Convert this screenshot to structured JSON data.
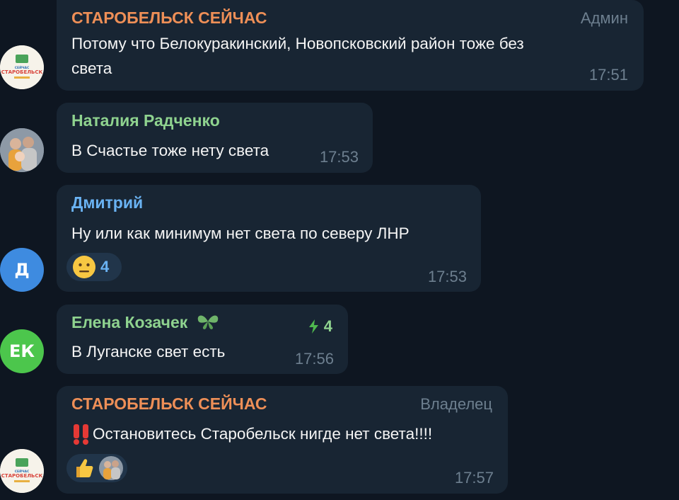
{
  "messages": [
    {
      "sender": "СТАРОБЕЛЬСК СЕЙЧАС",
      "sender_color": "#ee8f57",
      "role": "Админ",
      "lines": [
        "Потому что Белокуракинский, Новопсковский район тоже без",
        "света"
      ],
      "time": "17:51",
      "avatar_text": "СТАРОБЕЛЬСК",
      "avatar_small_text": "СЕЙЧАС"
    },
    {
      "sender": "Наталия Радченко",
      "sender_color": "#8fd38f",
      "lines": [
        "В Счастье тоже нету света"
      ],
      "time": "17:53"
    },
    {
      "sender": "Дмитрий",
      "sender_color": "#6ab3f3",
      "lines": [
        "Ну или как минимум нет света по северу ЛНР"
      ],
      "time": "17:53",
      "avatar_letter": "Д",
      "reaction_count": "4"
    },
    {
      "sender": "Елена Козачек",
      "sender_color": "#8fd38f",
      "boost_count": "4",
      "lines": [
        "В Луганске свет есть"
      ],
      "time": "17:56",
      "avatar_letter": "ЕК"
    },
    {
      "sender": "СТАРОБЕЛЬСК СЕЙЧАС",
      "sender_color": "#ee8f57",
      "role": "Владелец",
      "lines": [
        "Остановитесь Старобельск нигде нет света!!!!"
      ],
      "time": "17:57",
      "avatar_text": "СТАРОБЕЛЬСК",
      "avatar_small_text": "СЕЙЧАС"
    }
  ],
  "icons": {
    "neutral_face": "neutral-face-emoji",
    "thumbs_up": "thumbs-up-emoji",
    "double_exclamation": "double-exclamation-emoji",
    "butterfly": "butterfly-emoji",
    "boost": "lightning-boost-icon"
  },
  "colors": {
    "background": "#0e1621",
    "bubble": "#182533",
    "avatar_blue": "#3e8be0",
    "avatar_green": "#4cc64c"
  }
}
